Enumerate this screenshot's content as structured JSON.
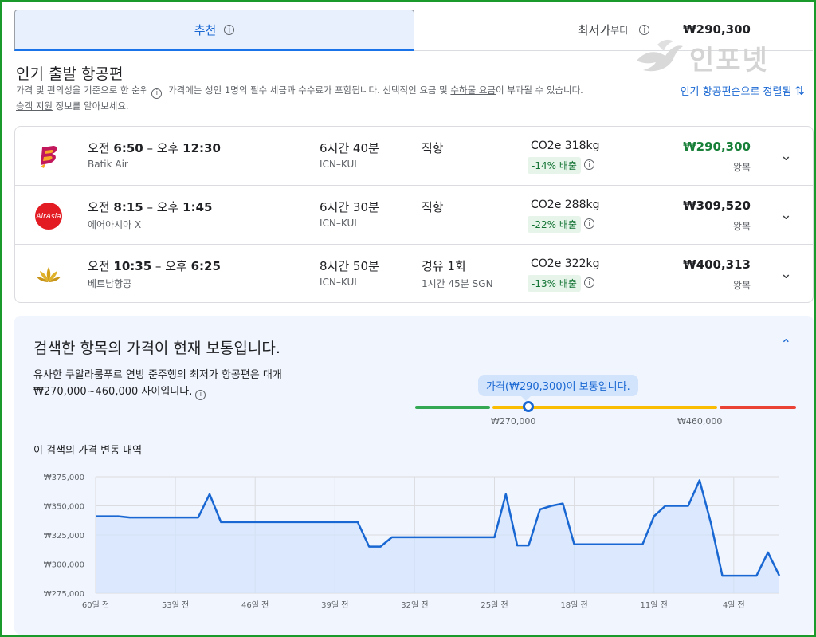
{
  "tabs": {
    "recommended_label": "추천",
    "cheapest_label": "최저가",
    "cheapest_price": "₩290,300",
    "cheapest_suffix": "부터"
  },
  "watermark": "인포넷",
  "section": {
    "title": "인기 출발 항공편",
    "desc_part1": "가격 및 편의성을 기준으로 한 순위",
    "desc_part2": "가격에는 성인 1명의 필수 세금과 수수료가 포함됩니다. 선택적인 요금 및",
    "desc_link1": "수하물 요금",
    "desc_part3": "이 부과될 수 있습니다.",
    "desc_link2": "승객 지원",
    "desc_part4": "정보를 알아보세요.",
    "sort_label": "인기 항공편순으로 정렬됨"
  },
  "flights": [
    {
      "logo": "batik-air-logo",
      "time_am": "오전",
      "time_dep": "6:50",
      "time_sep": " – ",
      "time_pm": "오후",
      "time_arr": "12:30",
      "airline": "Batik Air",
      "duration": "6시간 40분",
      "route": "ICN–KUL",
      "stops": "직항",
      "stop_detail": "",
      "co2": "CO2e 318kg",
      "emission": "-14% 배출",
      "price": "₩290,300",
      "trip": "왕복",
      "price_color": "#188038"
    },
    {
      "logo": "airasia-logo",
      "time_am": "오전",
      "time_dep": "8:15",
      "time_sep": " – ",
      "time_pm": "오후",
      "time_arr": "1:45",
      "airline": "에어아시아 X",
      "duration": "6시간 30분",
      "route": "ICN–KUL",
      "stops": "직항",
      "stop_detail": "",
      "co2": "CO2e 288kg",
      "emission": "-22% 배출",
      "price": "₩309,520",
      "trip": "왕복",
      "price_color": "#202124"
    },
    {
      "logo": "vietnam-airlines-logo",
      "time_am": "오전",
      "time_dep": "10:35",
      "time_sep": " – ",
      "time_pm": "오후",
      "time_arr": "6:25",
      "airline": "베트남항공",
      "duration": "8시간 50분",
      "route": "ICN–KUL",
      "stops": "경유 1회",
      "stop_detail": "1시간 45분 SGN",
      "co2": "CO2e 322kg",
      "emission": "-13% 배출",
      "price": "₩400,313",
      "trip": "왕복",
      "price_color": "#202124"
    }
  ],
  "insight": {
    "title": "검색한 항목의 가격이 현재 보통입니다.",
    "desc_line1": "유사한 쿠알라룸푸르 연방 준주행의 최저가 항공편은 대개",
    "desc_line2": "₩270,000~460,000 사이입니다.",
    "bubble": "가격(₩290,300)이 보통입니다.",
    "low_label": "₩270,000",
    "high_label": "₩460,000",
    "current_price": 290300,
    "history_title": "이 검색의 가격 변동 내역"
  },
  "chart_data": {
    "type": "area",
    "xlabel": "",
    "ylabel": "",
    "ylim": [
      275000,
      375000
    ],
    "yticks": [
      "₩375,000",
      "₩350,000",
      "₩325,000",
      "₩300,000",
      "₩275,000"
    ],
    "ytick_values": [
      375000,
      350000,
      325000,
      300000,
      275000
    ],
    "xticks": [
      "60일 전",
      "53일 전",
      "46일 전",
      "39일 전",
      "32일 전",
      "25일 전",
      "18일 전",
      "11일 전",
      "4일 전"
    ],
    "xtick_values": [
      -60,
      -53,
      -46,
      -39,
      -32,
      -25,
      -18,
      -11,
      -4
    ],
    "xlim": [
      -60,
      0
    ],
    "grid": true,
    "line_color": "#1967d2",
    "fill_color": "#d2e3fc",
    "x": [
      -60,
      -58,
      -57,
      -55,
      -51,
      -50,
      -49,
      -48,
      -46,
      -44,
      -42,
      -40,
      -39,
      -38,
      -37,
      -36,
      -35,
      -34,
      -32,
      -30,
      -28,
      -26,
      -25,
      -24,
      -23,
      -22,
      -21,
      -20,
      -19,
      -18,
      -17,
      -16,
      -14,
      -12,
      -11,
      -10,
      -9,
      -8,
      -7,
      -6,
      -5,
      -4,
      -3,
      -2,
      -1,
      0
    ],
    "values": [
      341000,
      341000,
      340000,
      340000,
      340000,
      360000,
      336000,
      336000,
      336000,
      336000,
      336000,
      336000,
      336000,
      336000,
      336000,
      315000,
      315000,
      323000,
      323000,
      323000,
      323000,
      323000,
      323000,
      360000,
      316000,
      316000,
      347000,
      350000,
      352000,
      317000,
      317000,
      317000,
      317000,
      317000,
      341000,
      350000,
      350000,
      350000,
      372000,
      335000,
      290000,
      290000,
      290000,
      290000,
      310000,
      290000
    ]
  }
}
